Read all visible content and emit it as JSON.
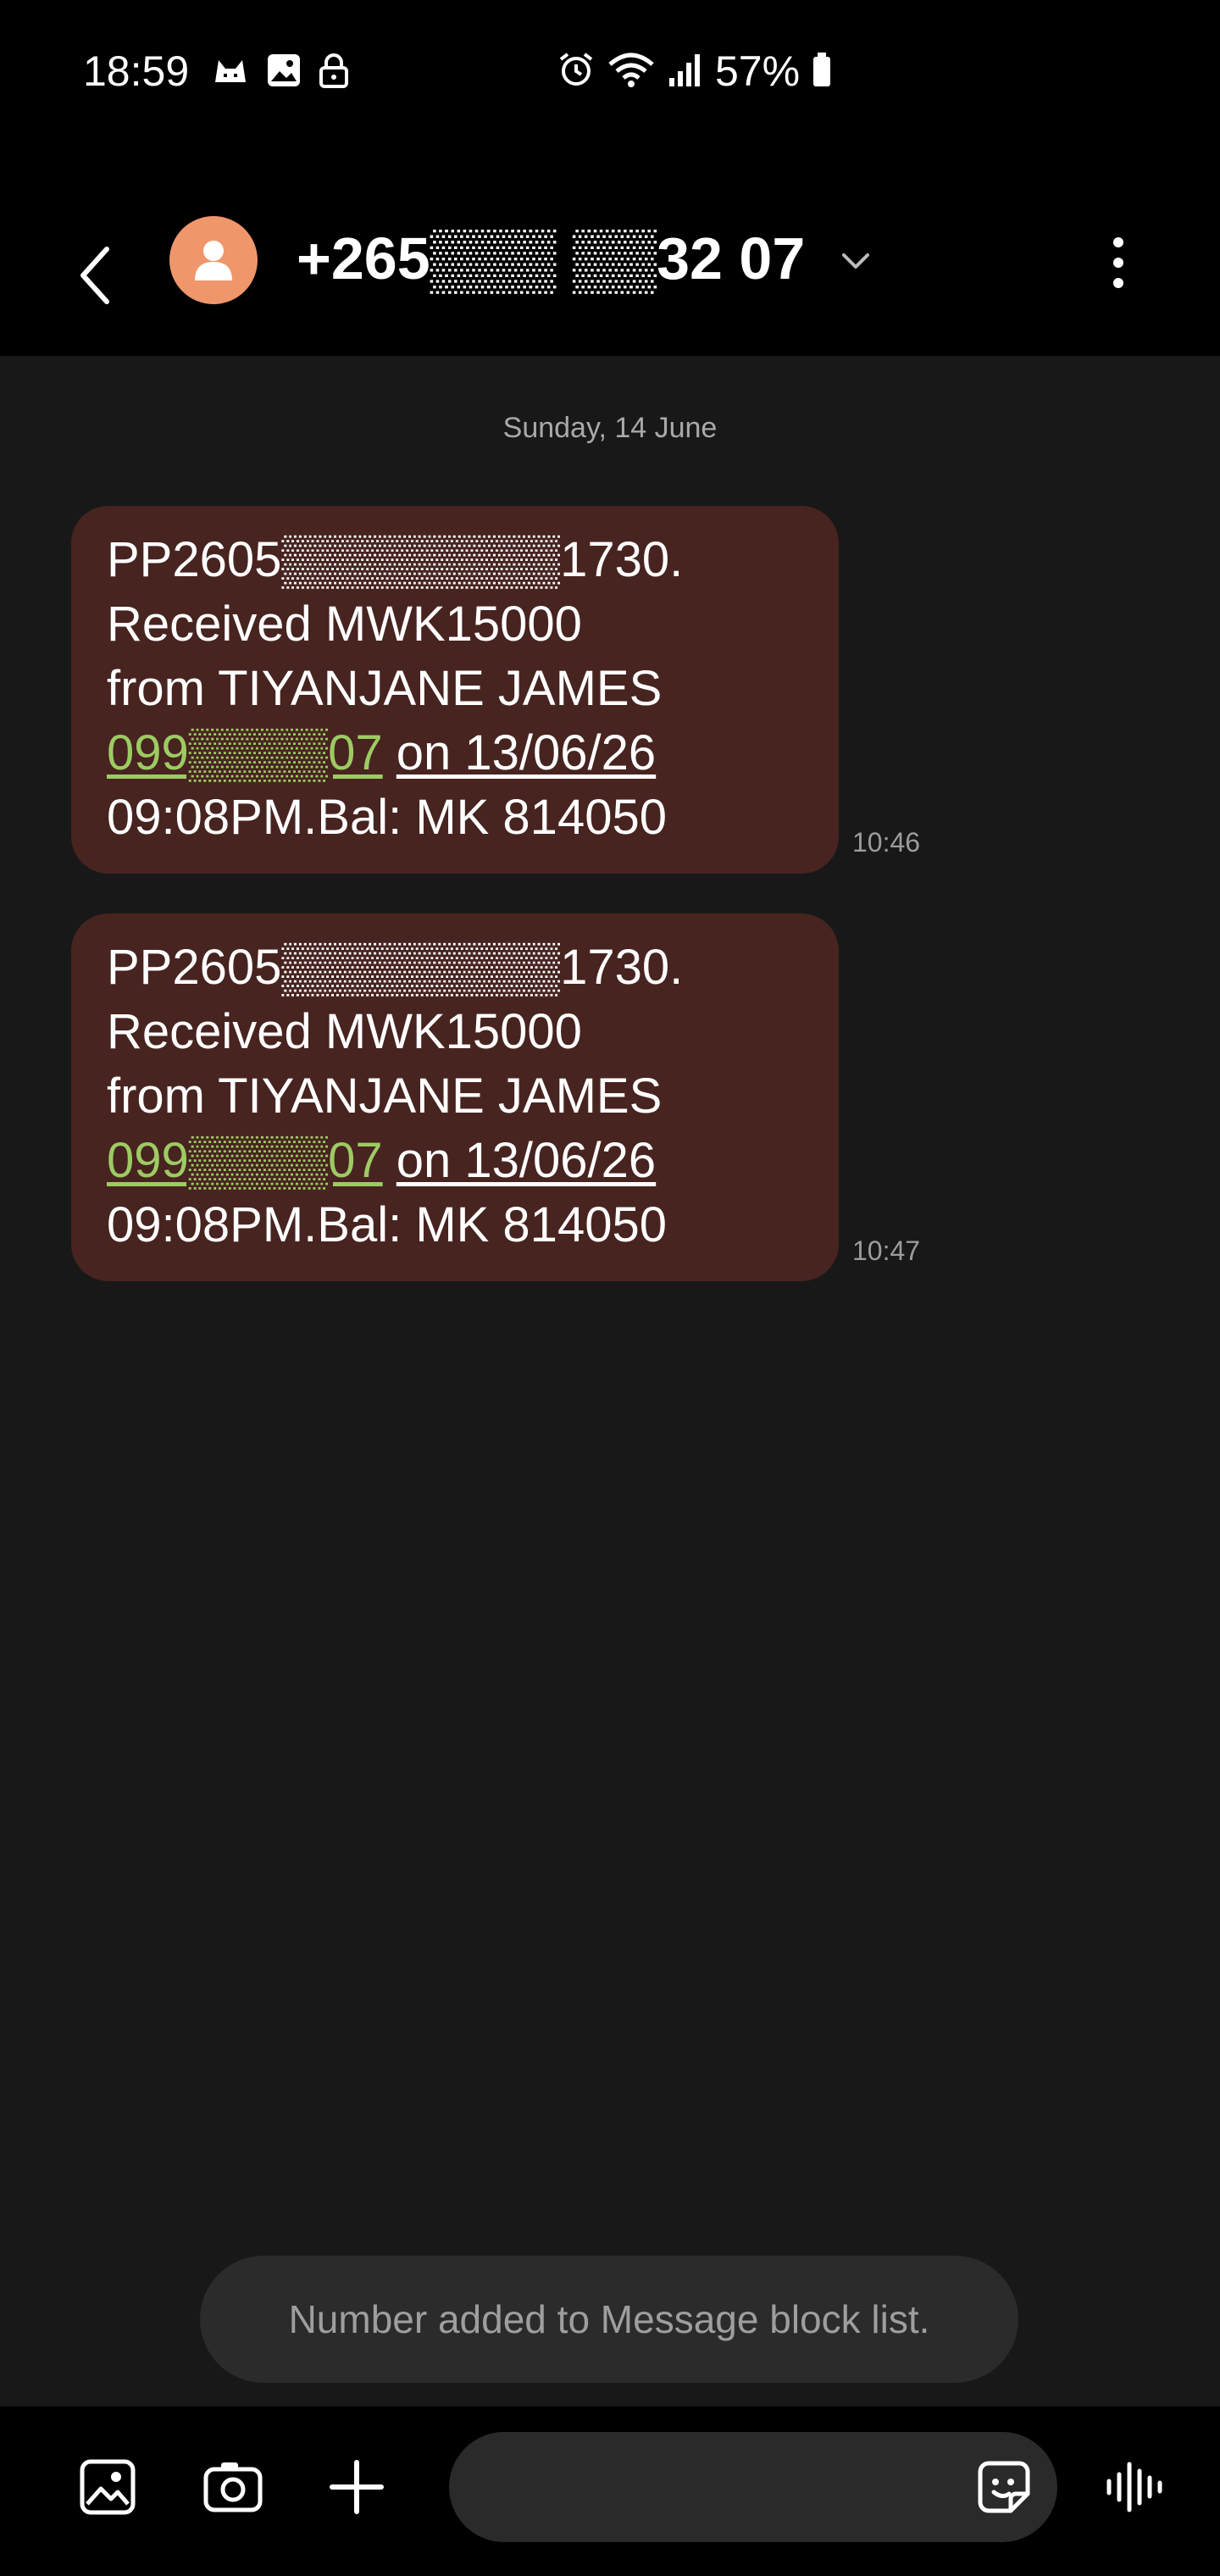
{
  "status_bar": {
    "time": "18:59",
    "battery": "57%",
    "icons_left": [
      "cat-notification-icon",
      "gallery-notification-icon",
      "lock-notification-icon"
    ],
    "icons_right": [
      "alarm-icon",
      "wifi-icon",
      "signal-icon",
      "battery-icon"
    ]
  },
  "header": {
    "contact": "+265▒▒▒ ▒▒32 07",
    "avatar_color": "#ef966b"
  },
  "conversation": {
    "date_separator": "Sunday, 14 June",
    "messages": [
      {
        "lines": [
          "PP2605▒▒▒▒▒▒▒▒1730.",
          "Received MWK15000",
          "from TIYANJANE JAMES"
        ],
        "phone_link": "099▒▒▒▒07",
        "date_link": "on 13/06/26",
        "last_line": "09:08PM.Bal: MK 814050",
        "time": "10:46"
      },
      {
        "lines": [
          "PP2605▒▒▒▒▒▒▒▒1730.",
          "Received MWK15000",
          "from TIYANJANE JAMES"
        ],
        "phone_link": "099▒▒▒▒07",
        "date_link": "on 13/06/26",
        "last_line": "09:08PM.Bal: MK 814050",
        "time": "10:47"
      }
    ],
    "bubble_color": "#472420",
    "link_color": "#9dcb63"
  },
  "toast": {
    "text": "Number added to Message block list."
  },
  "composer": {
    "placeholder": ""
  }
}
